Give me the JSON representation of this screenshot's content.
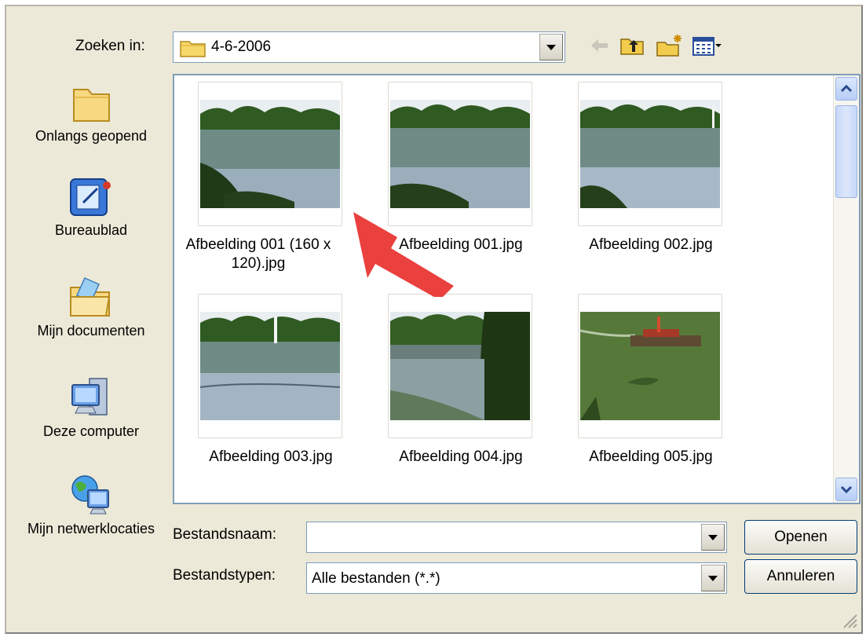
{
  "look_in": {
    "label": "Zoeken in:",
    "value": "4-6-2006"
  },
  "toolbar": {
    "icons": [
      "back-arrow-icon",
      "up-folder-icon",
      "new-folder-icon",
      "view-menu-icon"
    ]
  },
  "places": [
    {
      "label": "Onlangs geopend",
      "icon": "recent-folder-icon"
    },
    {
      "label": "Bureaublad",
      "icon": "desktop-icon"
    },
    {
      "label": "Mijn documenten",
      "icon": "my-documents-icon"
    },
    {
      "label": "Deze computer",
      "icon": "my-computer-icon"
    },
    {
      "label": "Mijn netwerklocaties",
      "icon": "network-places-icon"
    }
  ],
  "files": [
    {
      "name": "Afbeelding 001 (160 x 120).jpg"
    },
    {
      "name": "Afbeelding 001.jpg"
    },
    {
      "name": "Afbeelding 002.jpg"
    },
    {
      "name": "Afbeelding 003.jpg"
    },
    {
      "name": "Afbeelding 004.jpg"
    },
    {
      "name": "Afbeelding 005.jpg"
    }
  ],
  "filename": {
    "label": "Bestandsnaam:",
    "value": ""
  },
  "filetype": {
    "label": "Bestandstypen:",
    "value": "Alle bestanden (*.*)"
  },
  "buttons": {
    "open": "Openen",
    "cancel": "Annuleren"
  },
  "colors": {
    "dialog_bg": "#ece9d8",
    "field_border": "#7f9db9",
    "annotation_arrow": "#e8302e"
  }
}
